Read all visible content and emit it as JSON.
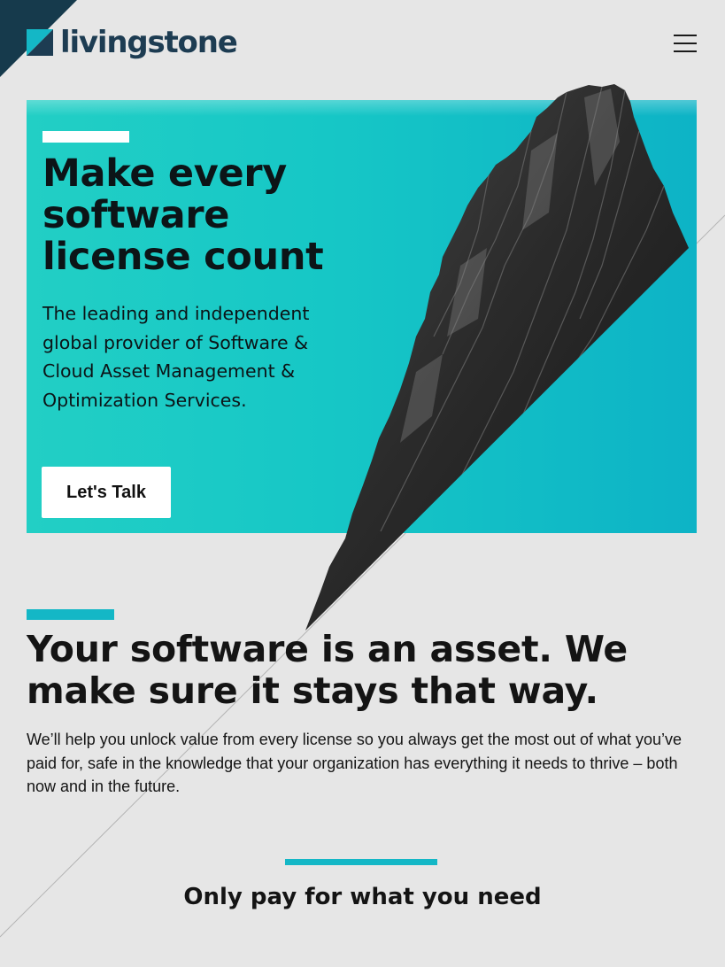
{
  "brand": {
    "name": "livingstone",
    "accent_color": "#14b7c6",
    "logo_color": "#1d3c52"
  },
  "header": {
    "menu_icon": "hamburger-menu-icon"
  },
  "hero": {
    "title": "Make every software license count",
    "subtitle": "The leading and independent global provider of Software & Cloud Asset Management & Optimization Services.",
    "cta_label": "Let's Talk",
    "background_color": "#16c7c6"
  },
  "section_asset": {
    "title": "Your software is an asset. We make sure it stays that way.",
    "body": "We’ll help you unlock value from every license so you always get the most out of what you’ve paid for, safe in the knowledge that your organization has everything it needs to thrive – both now and in the future."
  },
  "section_pay": {
    "title": "Only pay for what you need"
  }
}
